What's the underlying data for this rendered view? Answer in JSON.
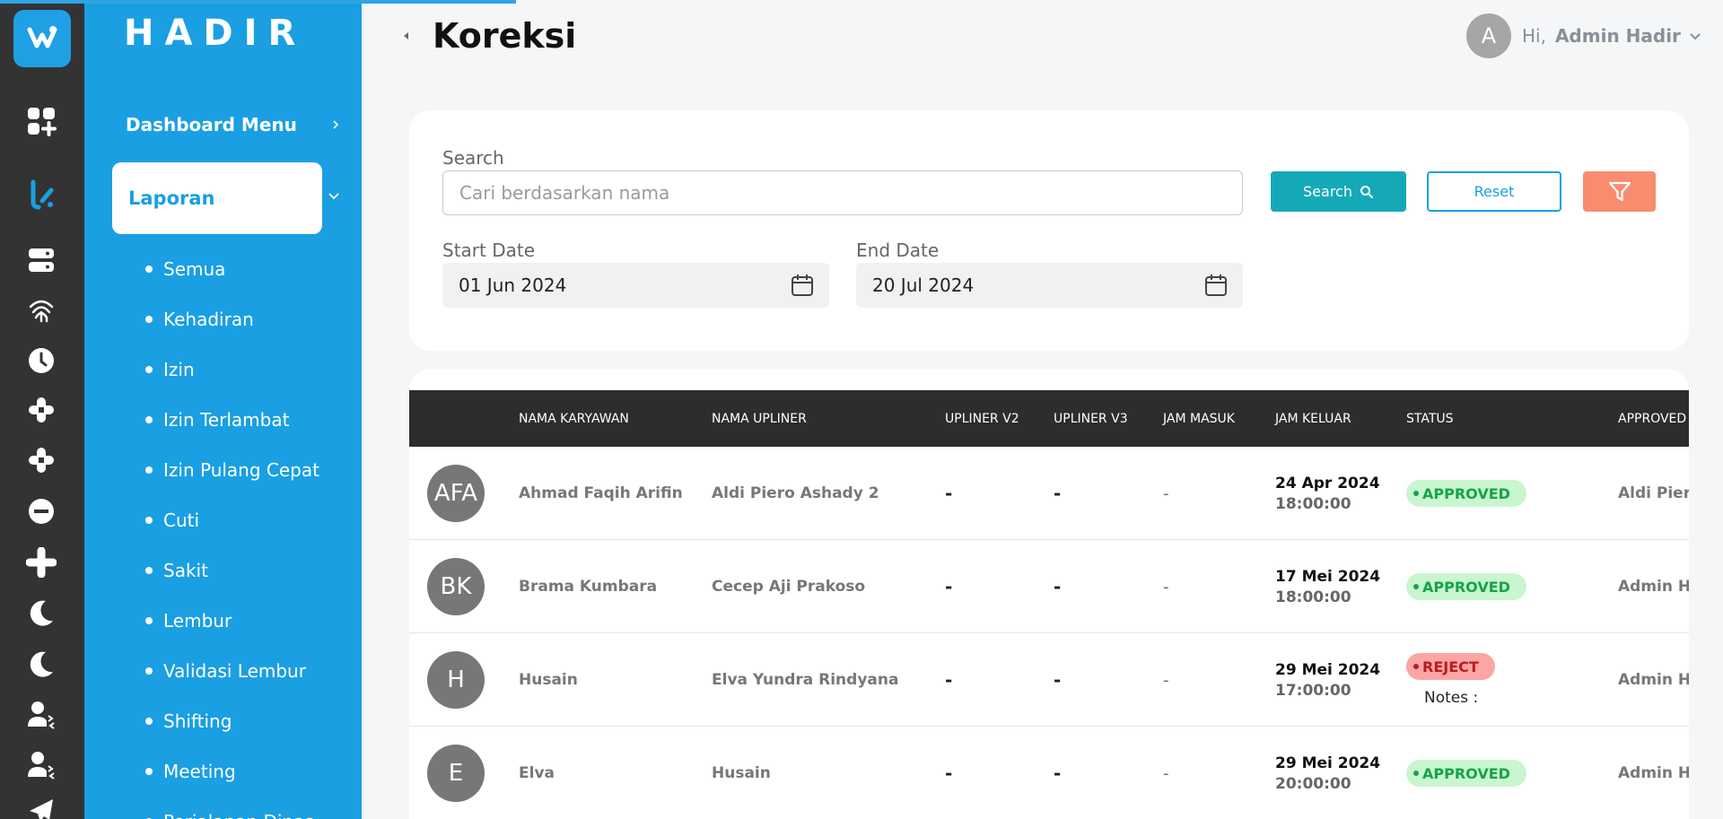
{
  "app": {
    "brand": "HADIR",
    "page_title": "Koreksi"
  },
  "user": {
    "avatar_initial": "A",
    "greeting": "Hi,",
    "name": "Admin Hadir"
  },
  "sidebar": {
    "menu_head": "Dashboard Menu",
    "active_item": "Laporan",
    "items": [
      {
        "label": "Semua"
      },
      {
        "label": "Kehadiran"
      },
      {
        "label": "Izin"
      },
      {
        "label": "Izin Terlambat"
      },
      {
        "label": "Izin Pulang Cepat"
      },
      {
        "label": "Cuti"
      },
      {
        "label": "Sakit"
      },
      {
        "label": "Lembur"
      },
      {
        "label": "Validasi Lembur"
      },
      {
        "label": "Shifting"
      },
      {
        "label": "Meeting"
      },
      {
        "label": "Perjalanan Dinas"
      }
    ],
    "rail_icons": [
      "dashboard-add-icon",
      "report-icon",
      "server-icon",
      "fingerprint-icon",
      "clock-icon",
      "hub-icon",
      "hub-icon-2",
      "minus-circle-icon",
      "plus-icon",
      "moon-icon",
      "moon-icon-2",
      "user-swap-icon",
      "user-swap-icon-2",
      "plane-icon"
    ]
  },
  "filter": {
    "search_label": "Search",
    "search_placeholder": "Cari berdasarkan nama",
    "start_label": "Start Date",
    "start_value": "01 Jun 2024",
    "end_label": "End Date",
    "end_value": "20 Jul 2024",
    "search_button": "Search",
    "reset_button": "Reset"
  },
  "table": {
    "headers": {
      "nama_karyawan": "NAMA KARYAWAN",
      "nama_upliner": "NAMA UPLINER",
      "upliner_v2": "UPLINER V2",
      "upliner_v3": "UPLINER V3",
      "jam_masuk": "JAM MASUK",
      "jam_keluar": "JAM KELUAR",
      "status": "STATUS",
      "approved": "APPROVED"
    },
    "rows": [
      {
        "initials": "AFA",
        "nama": "Ahmad Faqih Arifin",
        "upliner": "Aldi Piero Ashady 2",
        "v2": "-",
        "v3": "-",
        "jam_masuk": "-",
        "jk_date": "24 Apr 2024",
        "jk_time": "18:00:00",
        "status": "APPROVED",
        "notes": "",
        "approved_by": "Aldi Piero"
      },
      {
        "initials": "BK",
        "nama": "Brama Kumbara",
        "upliner": "Cecep Aji Prakoso",
        "v2": "-",
        "v3": "-",
        "jam_masuk": "-",
        "jk_date": "17 Mei 2024",
        "jk_time": "18:00:00",
        "status": "APPROVED",
        "notes": "",
        "approved_by": "Admin Ha"
      },
      {
        "initials": "H",
        "nama": "Husain",
        "upliner": "Elva Yundra Rindyana",
        "v2": "-",
        "v3": "-",
        "jam_masuk": "-",
        "jk_date": "29 Mei 2024",
        "jk_time": "17:00:00",
        "status": "REJECT",
        "notes": "Notes :",
        "approved_by": "Admin Ha"
      },
      {
        "initials": "E",
        "nama": "Elva",
        "upliner": "Husain",
        "v2": "-",
        "v3": "-",
        "jam_masuk": "-",
        "jk_date": "29 Mei 2024",
        "jk_time": "20:00:00",
        "status": "APPROVED",
        "notes": "",
        "approved_by": "Admin Ha"
      }
    ]
  },
  "colors": {
    "sidebar_blue": "#1a9fe3",
    "rail_dark": "#333334",
    "search_button": "#15a9b8",
    "filter_button": "#f98c6e",
    "approved_bg": "#c9f5cf",
    "reject_bg": "#fca5a5"
  }
}
